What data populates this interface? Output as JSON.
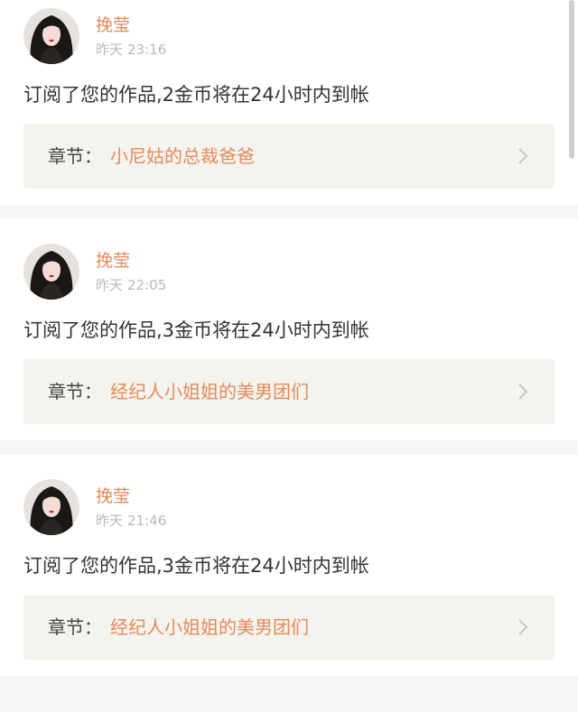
{
  "colors": {
    "accent": "#e7895a",
    "chapter_bg": "#f4f4ef",
    "card_bg": "#ffffff",
    "page_bg": "#f6f6f6",
    "chevron": "#c7c7c7"
  },
  "notifications": [
    {
      "username": "挽莹",
      "time_day": "昨天",
      "time_clock": "23:16",
      "message": "订阅了您的作品,2金币将在24小时内到帐",
      "chapter_label": "章节：",
      "chapter_title": "小尼姑的总裁爸爸",
      "chevron_icon": "chevron-right-icon"
    },
    {
      "username": "挽莹",
      "time_day": "昨天",
      "time_clock": "22:05",
      "message": "订阅了您的作品,3金币将在24小时内到帐",
      "chapter_label": "章节：",
      "chapter_title": "经纪人小姐姐的美男团们",
      "chevron_icon": "chevron-right-icon"
    },
    {
      "username": "挽莹",
      "time_day": "昨天",
      "time_clock": "21:46",
      "message": "订阅了您的作品,3金币将在24小时内到帐",
      "chapter_label": "章节：",
      "chapter_title": "经纪人小姐姐的美男团们",
      "chevron_icon": "chevron-right-icon"
    }
  ]
}
